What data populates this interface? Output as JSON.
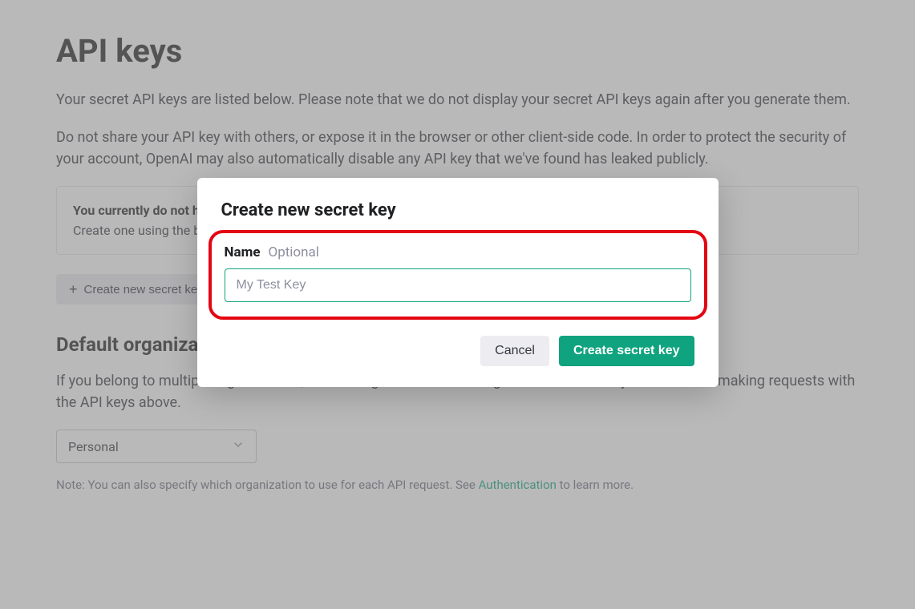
{
  "page": {
    "title": "API keys",
    "description1": "Your secret API keys are listed below. Please note that we do not display your secret API keys again after you generate them.",
    "description2": "Do not share your API key with others, or expose it in the browser or other client-side code. In order to protect the security of your account, OpenAI may also automatically disable any API key that we've found has leaked publicly."
  },
  "infoBox": {
    "title": "You currently do not have any API keys",
    "text": "Create one using the button below to get started"
  },
  "createButton": {
    "label": "Create new secret key"
  },
  "orgSection": {
    "heading": "Default organization",
    "description": "If you belong to multiple organizations, this setting controls which organization is used by default when making requests with the API keys above.",
    "selected": "Personal",
    "notePrefix": "Note: You can also specify which organization to use for each API request. See ",
    "noteLink": "Authentication",
    "noteSuffix": " to learn more."
  },
  "modal": {
    "title": "Create new secret key",
    "nameLabel": "Name",
    "nameOptional": "Optional",
    "namePlaceholder": "My Test Key",
    "nameValue": "",
    "cancelLabel": "Cancel",
    "submitLabel": "Create secret key"
  }
}
